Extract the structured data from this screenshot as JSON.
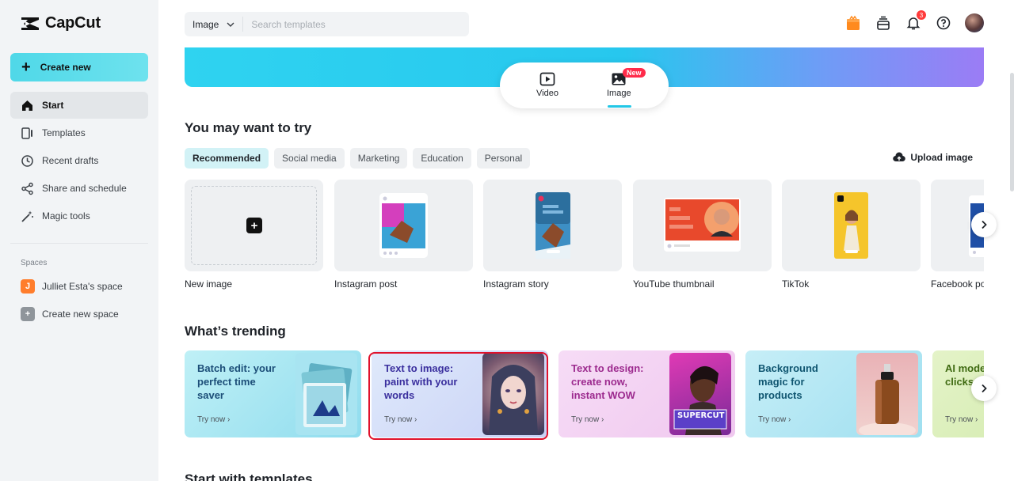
{
  "app": {
    "name": "CapCut"
  },
  "sidebar": {
    "create_label": "Create new",
    "items": [
      {
        "label": "Start",
        "icon": "home-icon",
        "active": true
      },
      {
        "label": "Templates",
        "icon": "templates-icon"
      },
      {
        "label": "Recent drafts",
        "icon": "clock-icon"
      },
      {
        "label": "Share and schedule",
        "icon": "share-icon"
      },
      {
        "label": "Magic tools",
        "icon": "magic-wand-icon"
      }
    ],
    "spaces_title": "Spaces",
    "spaces": [
      {
        "label": "Julliet Esta's space",
        "badge": "J",
        "color": "#ff7d2c"
      },
      {
        "label": "Create new space",
        "badge": "+",
        "color": "#8f959b"
      }
    ]
  },
  "header": {
    "search_type": "Image",
    "search_placeholder": "Search templates",
    "notifications": "3"
  },
  "switcher": {
    "video_label": "Video",
    "image_label": "Image",
    "new_badge": "New"
  },
  "try_section": {
    "title": "You may want to try",
    "chips": [
      "Recommended",
      "Social media",
      "Marketing",
      "Education",
      "Personal"
    ],
    "upload_label": "Upload image",
    "templates": [
      "New image",
      "Instagram post",
      "Instagram story",
      "YouTube thumbnail",
      "TikTok",
      "Facebook po"
    ]
  },
  "trending": {
    "title": "What’s trending",
    "try_label": "Try now",
    "cards": [
      {
        "text": "Batch edit: your perfect time saver",
        "color": "#1c4e78"
      },
      {
        "text": "Text to image: paint with your words",
        "color": "#3a2f9e"
      },
      {
        "text": "Text to design: create now, instant WOW",
        "color": "#9c2a8e"
      },
      {
        "text": "Background magic for products",
        "color": "#0f5570"
      },
      {
        "text": "AI mode fashio clicks",
        "color": "#3f6a12"
      }
    ],
    "supercut": "SUPERCUT"
  },
  "templates_section": {
    "title": "Start with templates"
  },
  "colors": {
    "accent": "#22c7e6",
    "selected": "#e0112b"
  }
}
